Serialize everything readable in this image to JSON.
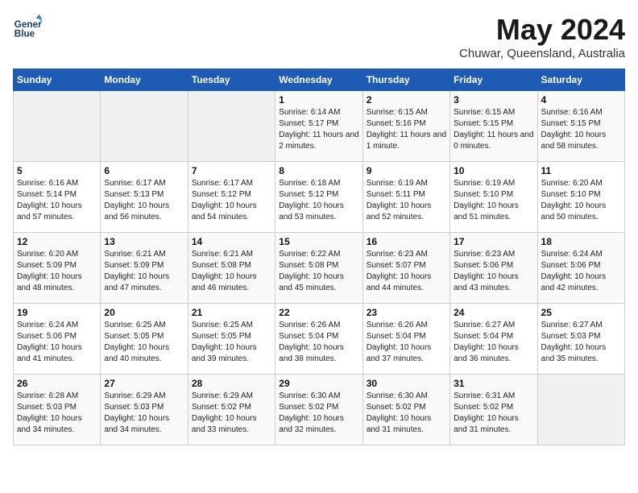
{
  "header": {
    "logo_line1": "General",
    "logo_line2": "Blue",
    "month_title": "May 2024",
    "location": "Chuwar, Queensland, Australia"
  },
  "calendar": {
    "weekdays": [
      "Sunday",
      "Monday",
      "Tuesday",
      "Wednesday",
      "Thursday",
      "Friday",
      "Saturday"
    ],
    "weeks": [
      [
        {
          "day": "",
          "sunrise": "",
          "sunset": "",
          "daylight": "",
          "empty": true
        },
        {
          "day": "",
          "sunrise": "",
          "sunset": "",
          "daylight": "",
          "empty": true
        },
        {
          "day": "",
          "sunrise": "",
          "sunset": "",
          "daylight": "",
          "empty": true
        },
        {
          "day": "1",
          "sunrise": "Sunrise: 6:14 AM",
          "sunset": "Sunset: 5:17 PM",
          "daylight": "Daylight: 11 hours and 2 minutes."
        },
        {
          "day": "2",
          "sunrise": "Sunrise: 6:15 AM",
          "sunset": "Sunset: 5:16 PM",
          "daylight": "Daylight: 11 hours and 1 minute."
        },
        {
          "day": "3",
          "sunrise": "Sunrise: 6:15 AM",
          "sunset": "Sunset: 5:15 PM",
          "daylight": "Daylight: 11 hours and 0 minutes."
        },
        {
          "day": "4",
          "sunrise": "Sunrise: 6:16 AM",
          "sunset": "Sunset: 5:15 PM",
          "daylight": "Daylight: 10 hours and 58 minutes."
        }
      ],
      [
        {
          "day": "5",
          "sunrise": "Sunrise: 6:16 AM",
          "sunset": "Sunset: 5:14 PM",
          "daylight": "Daylight: 10 hours and 57 minutes."
        },
        {
          "day": "6",
          "sunrise": "Sunrise: 6:17 AM",
          "sunset": "Sunset: 5:13 PM",
          "daylight": "Daylight: 10 hours and 56 minutes."
        },
        {
          "day": "7",
          "sunrise": "Sunrise: 6:17 AM",
          "sunset": "Sunset: 5:12 PM",
          "daylight": "Daylight: 10 hours and 54 minutes."
        },
        {
          "day": "8",
          "sunrise": "Sunrise: 6:18 AM",
          "sunset": "Sunset: 5:12 PM",
          "daylight": "Daylight: 10 hours and 53 minutes."
        },
        {
          "day": "9",
          "sunrise": "Sunrise: 6:19 AM",
          "sunset": "Sunset: 5:11 PM",
          "daylight": "Daylight: 10 hours and 52 minutes."
        },
        {
          "day": "10",
          "sunrise": "Sunrise: 6:19 AM",
          "sunset": "Sunset: 5:10 PM",
          "daylight": "Daylight: 10 hours and 51 minutes."
        },
        {
          "day": "11",
          "sunrise": "Sunrise: 6:20 AM",
          "sunset": "Sunset: 5:10 PM",
          "daylight": "Daylight: 10 hours and 50 minutes."
        }
      ],
      [
        {
          "day": "12",
          "sunrise": "Sunrise: 6:20 AM",
          "sunset": "Sunset: 5:09 PM",
          "daylight": "Daylight: 10 hours and 48 minutes."
        },
        {
          "day": "13",
          "sunrise": "Sunrise: 6:21 AM",
          "sunset": "Sunset: 5:09 PM",
          "daylight": "Daylight: 10 hours and 47 minutes."
        },
        {
          "day": "14",
          "sunrise": "Sunrise: 6:21 AM",
          "sunset": "Sunset: 5:08 PM",
          "daylight": "Daylight: 10 hours and 46 minutes."
        },
        {
          "day": "15",
          "sunrise": "Sunrise: 6:22 AM",
          "sunset": "Sunset: 5:08 PM",
          "daylight": "Daylight: 10 hours and 45 minutes."
        },
        {
          "day": "16",
          "sunrise": "Sunrise: 6:23 AM",
          "sunset": "Sunset: 5:07 PM",
          "daylight": "Daylight: 10 hours and 44 minutes."
        },
        {
          "day": "17",
          "sunrise": "Sunrise: 6:23 AM",
          "sunset": "Sunset: 5:06 PM",
          "daylight": "Daylight: 10 hours and 43 minutes."
        },
        {
          "day": "18",
          "sunrise": "Sunrise: 6:24 AM",
          "sunset": "Sunset: 5:06 PM",
          "daylight": "Daylight: 10 hours and 42 minutes."
        }
      ],
      [
        {
          "day": "19",
          "sunrise": "Sunrise: 6:24 AM",
          "sunset": "Sunset: 5:06 PM",
          "daylight": "Daylight: 10 hours and 41 minutes."
        },
        {
          "day": "20",
          "sunrise": "Sunrise: 6:25 AM",
          "sunset": "Sunset: 5:05 PM",
          "daylight": "Daylight: 10 hours and 40 minutes."
        },
        {
          "day": "21",
          "sunrise": "Sunrise: 6:25 AM",
          "sunset": "Sunset: 5:05 PM",
          "daylight": "Daylight: 10 hours and 39 minutes."
        },
        {
          "day": "22",
          "sunrise": "Sunrise: 6:26 AM",
          "sunset": "Sunset: 5:04 PM",
          "daylight": "Daylight: 10 hours and 38 minutes."
        },
        {
          "day": "23",
          "sunrise": "Sunrise: 6:26 AM",
          "sunset": "Sunset: 5:04 PM",
          "daylight": "Daylight: 10 hours and 37 minutes."
        },
        {
          "day": "24",
          "sunrise": "Sunrise: 6:27 AM",
          "sunset": "Sunset: 5:04 PM",
          "daylight": "Daylight: 10 hours and 36 minutes."
        },
        {
          "day": "25",
          "sunrise": "Sunrise: 6:27 AM",
          "sunset": "Sunset: 5:03 PM",
          "daylight": "Daylight: 10 hours and 35 minutes."
        }
      ],
      [
        {
          "day": "26",
          "sunrise": "Sunrise: 6:28 AM",
          "sunset": "Sunset: 5:03 PM",
          "daylight": "Daylight: 10 hours and 34 minutes."
        },
        {
          "day": "27",
          "sunrise": "Sunrise: 6:29 AM",
          "sunset": "Sunset: 5:03 PM",
          "daylight": "Daylight: 10 hours and 34 minutes."
        },
        {
          "day": "28",
          "sunrise": "Sunrise: 6:29 AM",
          "sunset": "Sunset: 5:02 PM",
          "daylight": "Daylight: 10 hours and 33 minutes."
        },
        {
          "day": "29",
          "sunrise": "Sunrise: 6:30 AM",
          "sunset": "Sunset: 5:02 PM",
          "daylight": "Daylight: 10 hours and 32 minutes."
        },
        {
          "day": "30",
          "sunrise": "Sunrise: 6:30 AM",
          "sunset": "Sunset: 5:02 PM",
          "daylight": "Daylight: 10 hours and 31 minutes."
        },
        {
          "day": "31",
          "sunrise": "Sunrise: 6:31 AM",
          "sunset": "Sunset: 5:02 PM",
          "daylight": "Daylight: 10 hours and 31 minutes."
        },
        {
          "day": "",
          "sunrise": "",
          "sunset": "",
          "daylight": "",
          "empty": true
        }
      ]
    ]
  }
}
